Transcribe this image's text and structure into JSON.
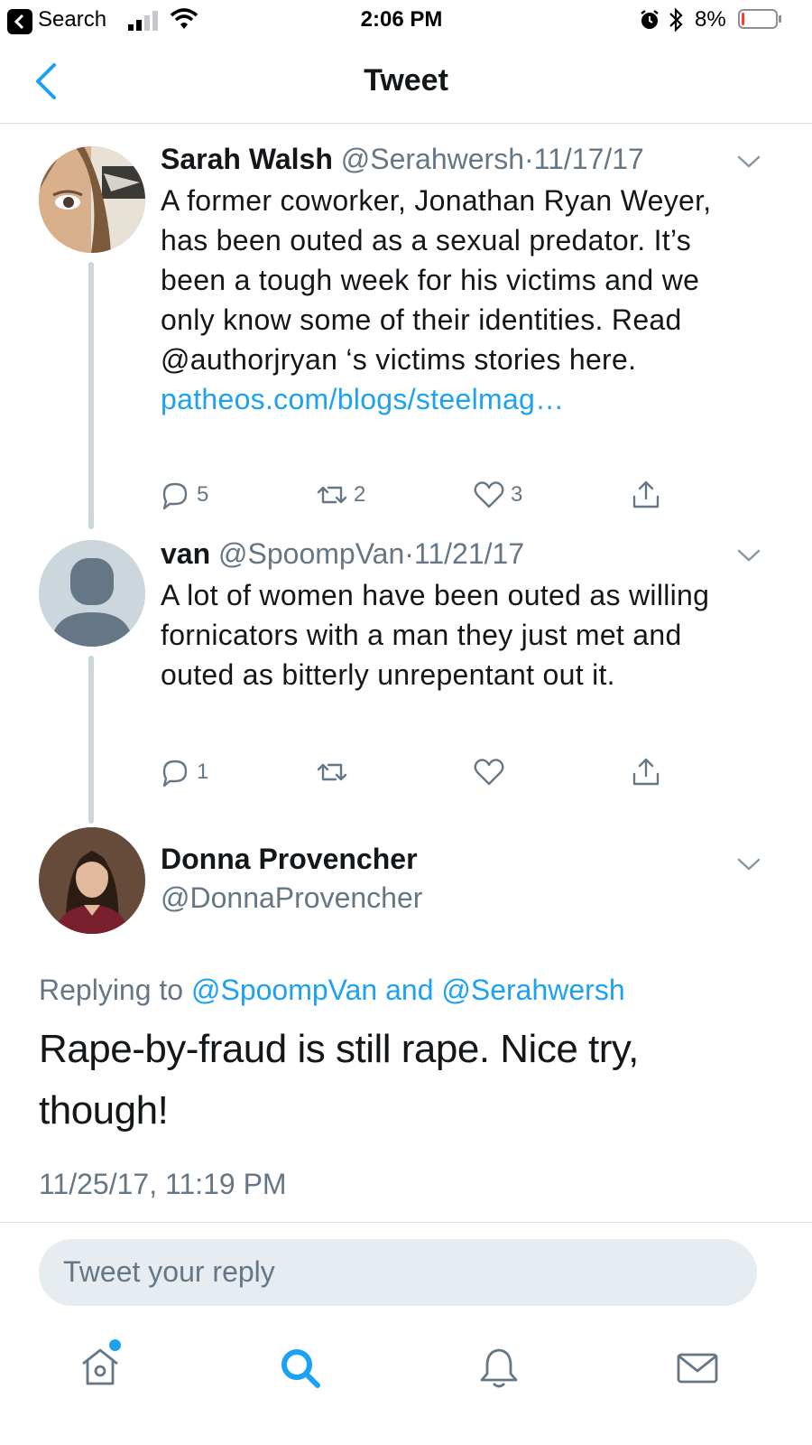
{
  "status_bar": {
    "back_app": "Search",
    "time": "2:06 PM",
    "battery_percent": "8%",
    "battery_level": 0.08
  },
  "nav": {
    "title": "Tweet",
    "back_icon": "chevron-left-icon"
  },
  "tweets": [
    {
      "name": "Sarah Walsh",
      "handle": "@Serahwersh",
      "sep": "·",
      "date": "11/17/17",
      "text": "A former coworker, Jonathan Ryan Weyer, has been outed as a sexual predator. It’s been a tough week for his victims and we only know some of their identities. Read @authorjryan ‘s victims stories here.",
      "link": "patheos.com/blogs/steelmag…",
      "reply_count": "5",
      "retweet_count": "2",
      "like_count": "3"
    },
    {
      "name": "van",
      "handle": "@SpoompVan",
      "sep": "·",
      "date": "11/21/17",
      "text": "A lot of women have been outed as willing fornicators with a man they just met and outed as bitterly unrepentant out it.",
      "reply_count": "1",
      "retweet_count": "",
      "like_count": ""
    }
  ],
  "main_tweet": {
    "name": "Donna Provencher",
    "handle": "@DonnaProvencher",
    "replying_prefix": "Replying to",
    "replying_to_1": "@SpoompVan",
    "replying_and": "and",
    "replying_to_2": "@Serahwersh",
    "text": "Rape-by-fraud is still rape. Nice try, though!",
    "timestamp": "11/25/17, 11:19 PM"
  },
  "reply_input": {
    "placeholder": "Tweet your reply"
  },
  "tab_bar": {
    "items": [
      {
        "icon": "home-icon",
        "active": false,
        "badge": true
      },
      {
        "icon": "search-icon",
        "active": true
      },
      {
        "icon": "bell-icon",
        "active": false
      },
      {
        "icon": "mail-icon",
        "active": false
      }
    ]
  },
  "colors": {
    "accent": "#1da1f2",
    "muted": "#657786",
    "text": "#14171a",
    "battery_low": "#ff3b30"
  }
}
